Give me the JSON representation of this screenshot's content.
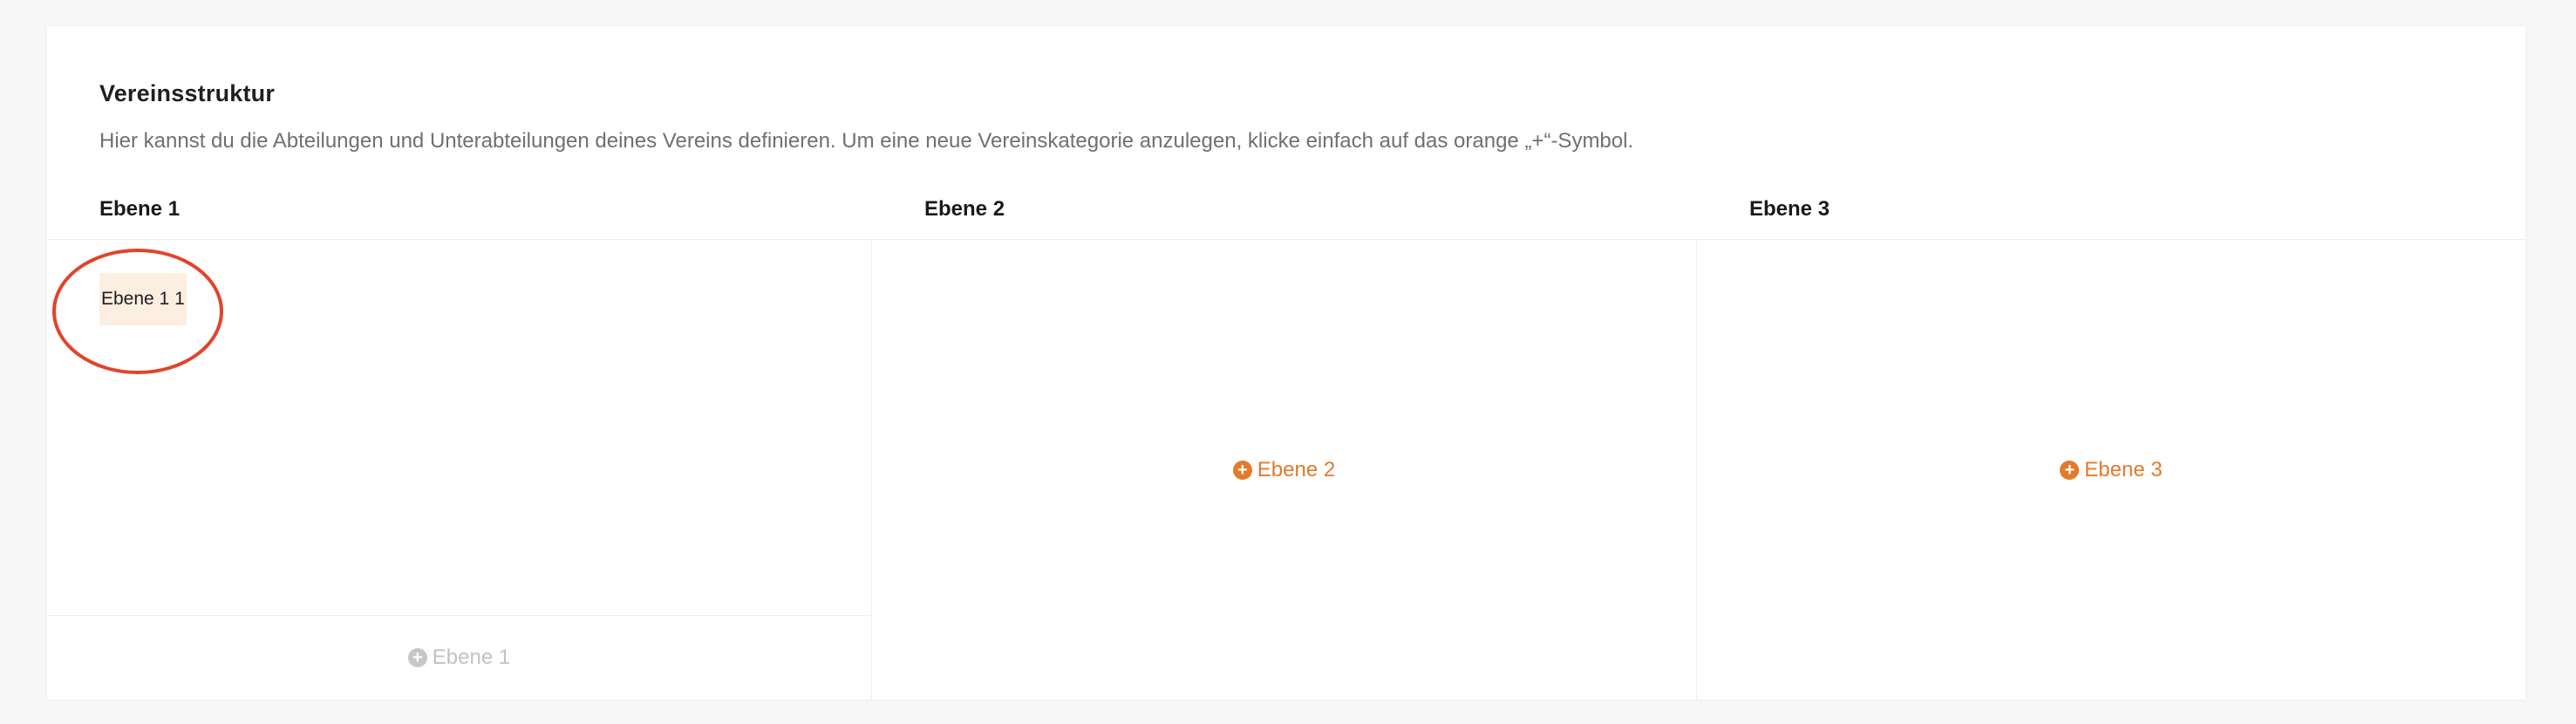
{
  "section": {
    "title": "Vereinsstruktur",
    "description": "Hier kannst du die Abteilungen und Unterabteilungen deines Vereins definieren. Um eine neue Vereinskategorie anzulegen, klicke einfach auf das orange „+“-Symbol."
  },
  "columns": [
    {
      "header": "Ebene 1",
      "items": [
        "Ebene 1 1"
      ],
      "add_label": "Ebene 1",
      "add_state": "disabled"
    },
    {
      "header": "Ebene 2",
      "items": [],
      "add_label": "Ebene 2",
      "add_state": "active"
    },
    {
      "header": "Ebene 3",
      "items": [],
      "add_label": "Ebene 3",
      "add_state": "active"
    }
  ],
  "icons": {
    "add": "plus-circle-icon"
  },
  "colors": {
    "accent": "#e27a2b",
    "chip_background": "#fdeee2",
    "disabled": "#c2c2c2",
    "annotation_ring": "#e3432b"
  }
}
